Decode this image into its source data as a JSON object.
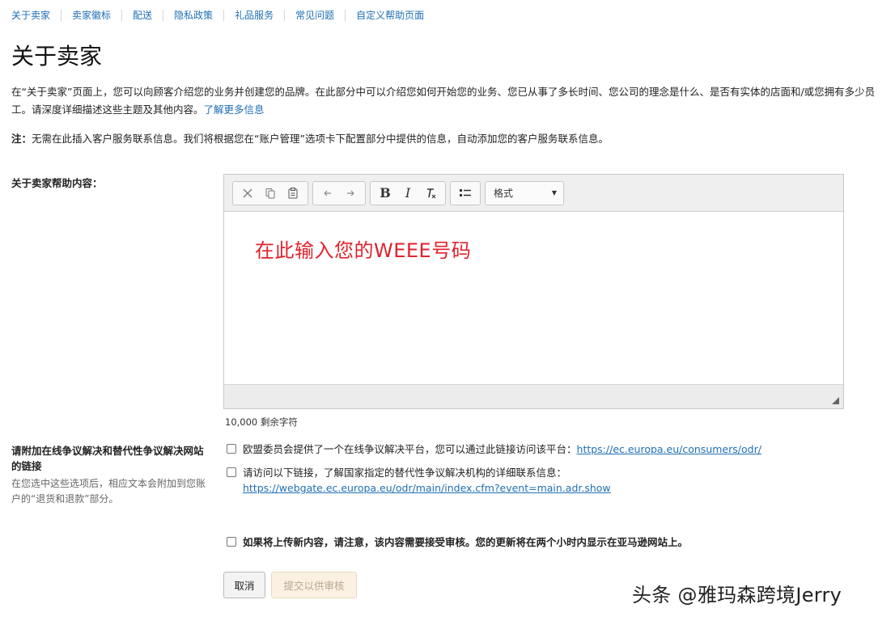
{
  "nav": {
    "items": [
      "关于卖家",
      "卖家徽标",
      "配送",
      "隐私政策",
      "礼品服务",
      "常见问题",
      "自定义帮助页面"
    ]
  },
  "page": {
    "title": "关于卖家",
    "intro_text": "在“关于卖家”页面上，您可以向顾客介绍您的业务并创建您的品牌。在此部分中可以介绍您如何开始您的业务、您已从事了多长时间、您公司的理念是什么、是否有实体的店面和/或您拥有多少员工。请深度详细描述这些主题及其他内容。",
    "intro_link": "了解更多信息",
    "note_label": "注：",
    "note_text": "无需在此插入客户服务联系信息。我们将根据您在“账户管理”选项卡下配置部分中提供的信息，自动添加您的客户服务联系信息。"
  },
  "help": {
    "label": "关于卖家帮助内容：",
    "toolbar": {
      "format_label": "格式"
    },
    "content": "在此输入您的WEEE号码",
    "char_count": "10,000 剩余字符"
  },
  "dispute": {
    "label": "请附加在线争议解决和替代性争议解决网站的链接",
    "hint": "在您选中这些选项后，相应文本会附加到您账户的“退货和退款”部分。",
    "options": [
      {
        "text": "欧盟委员会提供了一个在线争议解决平台，您可以通过此链接访问该平台：",
        "link": "https://ec.europa.eu/consumers/odr/"
      },
      {
        "text": "请访问以下链接，了解国家指定的替代性争议解决机构的详细联系信息：",
        "link": "https://webgate.ec.europa.eu/odr/main/index.cfm?event=main.adr.show"
      }
    ]
  },
  "confirm": {
    "text": "如果将上传新内容，请注意，该内容需要接受审核。您的更新将在两个小时内显示在亚马逊网站上。"
  },
  "buttons": {
    "cancel": "取消",
    "submit": "提交以供审核"
  },
  "watermark": "头条 @雅玛森跨境Jerry",
  "colors": {
    "link": "#1f6fb5",
    "editor_text": "#e0232e",
    "submit_bg": "#fbf1e2"
  }
}
